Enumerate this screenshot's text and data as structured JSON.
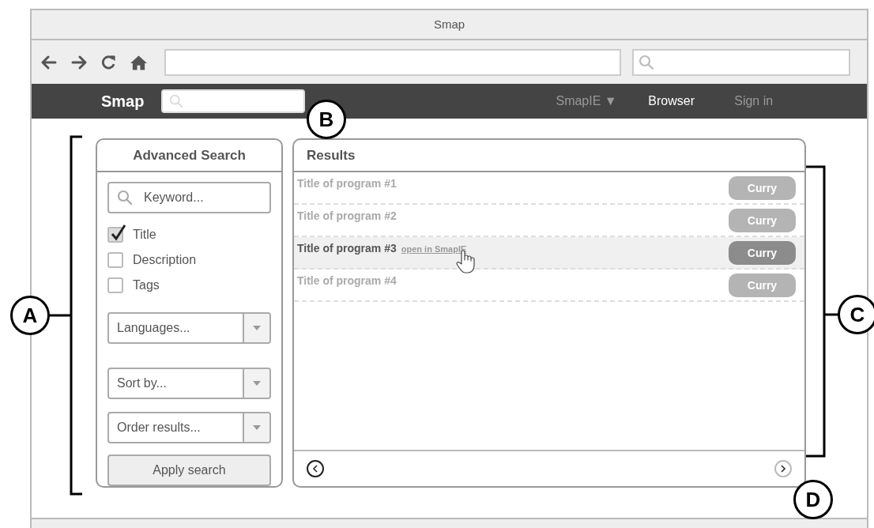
{
  "window": {
    "title": "Smap"
  },
  "navbar": {
    "brand": "Smap",
    "items": [
      {
        "label": "SmapIE ▼",
        "selected": false
      },
      {
        "label": "Browser",
        "selected": true
      },
      {
        "label": "Sign in",
        "selected": false
      }
    ]
  },
  "search_panel": {
    "title": "Advanced Search",
    "keyword": {
      "placeholder": "Keyword..."
    },
    "checkboxes": [
      {
        "label": "Title",
        "checked": true
      },
      {
        "label": "Description",
        "checked": false
      },
      {
        "label": "Tags",
        "checked": false
      }
    ],
    "dropdowns": [
      {
        "placeholder": "Languages..."
      },
      {
        "placeholder": "Sort by..."
      },
      {
        "placeholder": "Order results..."
      }
    ],
    "button": "Apply search"
  },
  "results": {
    "title": "Results",
    "rows": [
      {
        "title": "Title of program #1",
        "selected": false,
        "button": "Curry"
      },
      {
        "title": "Title of program #2",
        "selected": false,
        "button": "Curry"
      },
      {
        "title": "Title of program #3",
        "selected": true,
        "link": "open in SmapIE",
        "button": "Curry"
      },
      {
        "title": "Title of program #4",
        "selected": false,
        "button": "Curry"
      }
    ]
  },
  "callouts": [
    "A",
    "B",
    "C",
    "D"
  ]
}
